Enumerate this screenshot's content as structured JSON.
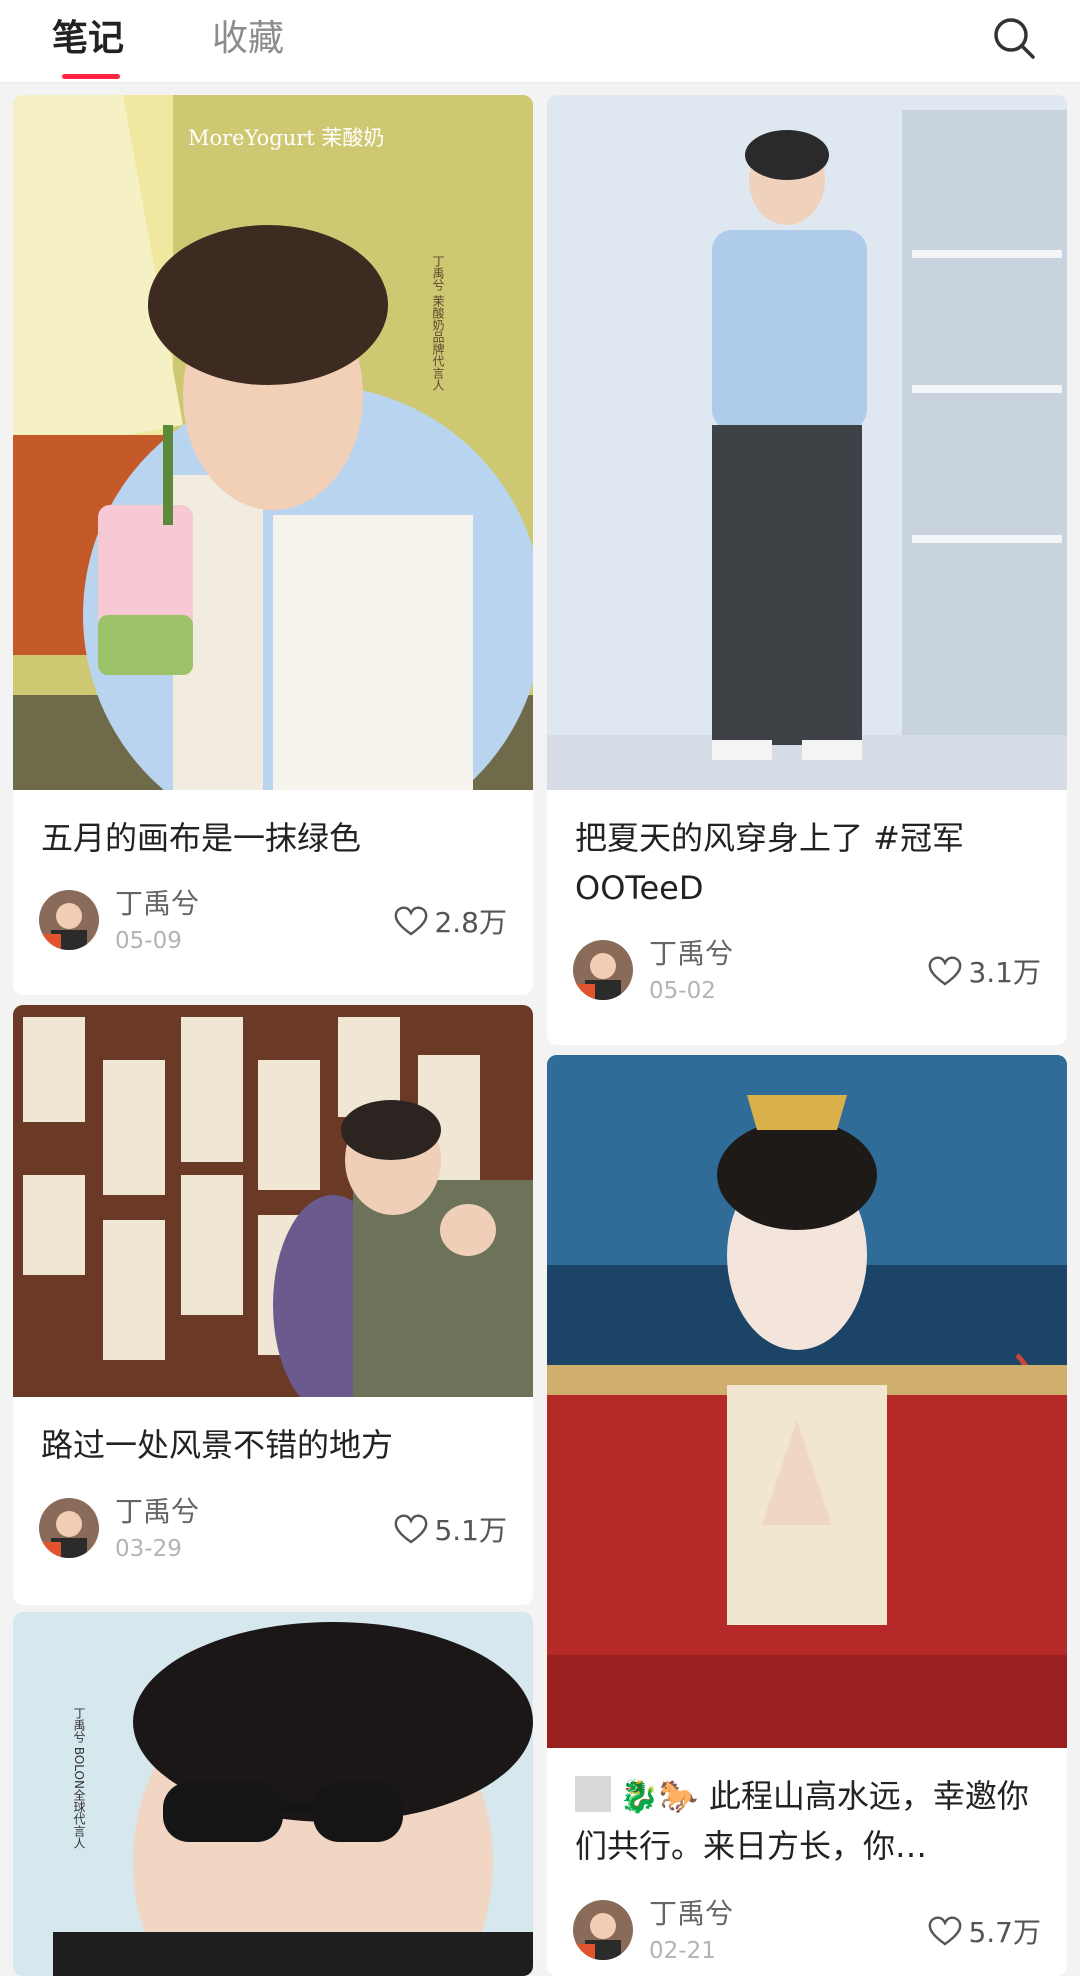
{
  "tabs": [
    {
      "label": "笔记",
      "active": true
    },
    {
      "label": "收藏",
      "active": false
    }
  ],
  "accent_color": "#ff2442",
  "search_icon": "search-icon",
  "like_icon": "heart-outline-icon",
  "cards": [
    {
      "title": "五月的画布是一抹绿色",
      "author": "丁禹兮",
      "date": "05-09",
      "likes": "2.8万",
      "image": {
        "brand": "MoreYogurt 茉酸奶",
        "side_text": "丁禹兮 茉酸奶品牌代言人"
      }
    },
    {
      "title": "把夏天的风穿身上了 #冠军OOTeeD",
      "author": "丁禹兮",
      "date": "05-02",
      "likes": "3.1万"
    },
    {
      "title": "路过一处风景不错的地方",
      "author": "丁禹兮",
      "date": "03-29",
      "likes": "5.1万"
    },
    {
      "title_emoji": "🐉🐎",
      "title": "此程山高水远，幸邀你们共行。来日方长，你…",
      "author": "丁禹兮",
      "date": "02-21",
      "likes": "5.7万"
    },
    {
      "image": {
        "side_text": "丁禹兮 BOLON全球代言人"
      }
    }
  ]
}
